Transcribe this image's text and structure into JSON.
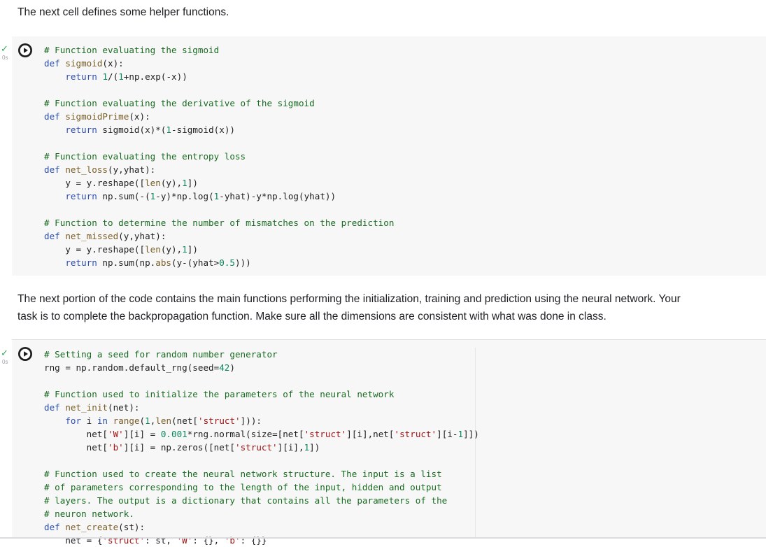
{
  "markdown": {
    "intro": "The next cell defines some helper functions.",
    "portion_line1": "The next portion of the code contains the main functions performing the initialization, training and prediction using the neural network. Your",
    "portion_line2": "task is to complete the backpropagation function. Make sure all the dimensions are consistent with what was done in class."
  },
  "cells": [
    {
      "status_icon": "checkmark-icon",
      "duration": "0s"
    },
    {
      "status_icon": "checkmark-icon",
      "duration": "0s"
    }
  ],
  "colors": {
    "check": "#34a853",
    "comment": "#1a6b22",
    "keyword": "#2d4fb0",
    "string": "#a31515",
    "number": "#098658",
    "cell_bg": "#f7f7f7"
  }
}
